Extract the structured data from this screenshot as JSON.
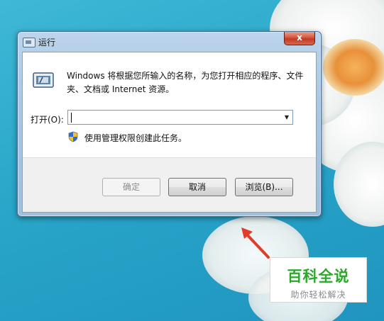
{
  "dialog": {
    "title": "运行",
    "close_glyph": "x",
    "description": "Windows 将根据您所输入的名称，为您打开相应的程序、文件夹、文档或 Internet 资源。",
    "open_label": "打开(O):",
    "open_value": "",
    "admin_note": "使用管理权限创建此任务。",
    "buttons": {
      "ok": "确定",
      "cancel": "取消",
      "browse": "浏览(B)..."
    }
  },
  "watermark": {
    "title": "百科全说",
    "subtitle": "助你轻松解决"
  },
  "icons": [
    "run-program-icon",
    "uac-shield-icon",
    "combo-dropdown-arrow-icon",
    "close-icon"
  ],
  "colors": {
    "accent_close": "#c03a22",
    "watermark_green": "#2ca62c",
    "arrow_red": "#e03b2c"
  }
}
